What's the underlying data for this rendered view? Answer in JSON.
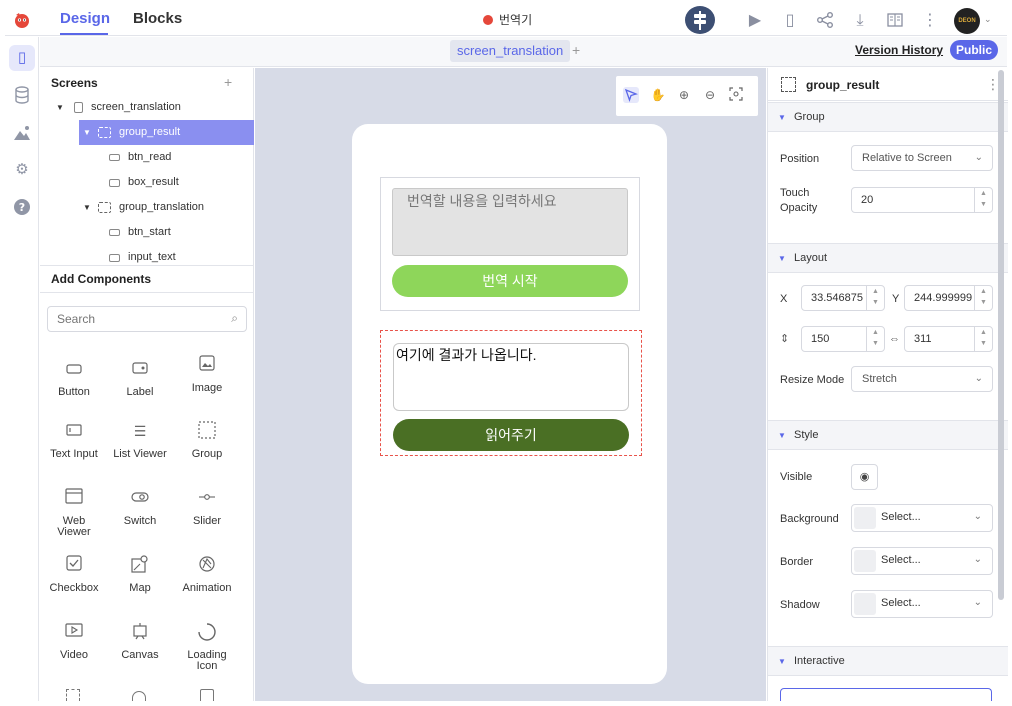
{
  "topbar": {
    "tabs": {
      "design": "Design",
      "blocks": "Blocks"
    },
    "app_title": "번역기",
    "avatar_text": "DEON"
  },
  "subbar": {
    "screen_tab": "screen_translation",
    "add_symbol": "+",
    "version_history": "Version History",
    "public_label": "Public"
  },
  "screens": {
    "title": "Screens",
    "add_symbol": "+",
    "tree": [
      {
        "label": "screen_translation"
      },
      {
        "label": "group_result"
      },
      {
        "label": "btn_read"
      },
      {
        "label": "box_result"
      },
      {
        "label": "group_translation"
      },
      {
        "label": "btn_start"
      },
      {
        "label": "input_text"
      }
    ]
  },
  "components": {
    "title": "Add Components",
    "search_placeholder": "Search",
    "items": [
      {
        "label": "Button",
        "icon": "button-icon"
      },
      {
        "label": "Label",
        "icon": "label-icon"
      },
      {
        "label": "Image",
        "icon": "image-icon"
      },
      {
        "label": "Text Input",
        "icon": "text-input-icon"
      },
      {
        "label": "List Viewer",
        "icon": "list-icon"
      },
      {
        "label": "Group",
        "icon": "group-icon"
      },
      {
        "label": "Web\nViewer",
        "icon": "web-viewer-icon"
      },
      {
        "label": "Switch",
        "icon": "switch-icon"
      },
      {
        "label": "Slider",
        "icon": "slider-icon"
      },
      {
        "label": "Checkbox",
        "icon": "checkbox-icon"
      },
      {
        "label": "Map",
        "icon": "map-icon"
      },
      {
        "label": "Animation",
        "icon": "animation-icon"
      },
      {
        "label": "Video",
        "icon": "video-icon"
      },
      {
        "label": "Canvas",
        "icon": "canvas-icon"
      },
      {
        "label": "Loading\nIcon",
        "icon": "loading-icon"
      }
    ]
  },
  "phone": {
    "input_placeholder": "번역할 내용을 입력하세요",
    "btn_start": "번역 시작",
    "box_result": "여기에 결과가 나옵니다.",
    "btn_read": "읽어주기"
  },
  "props": {
    "title": "group_result",
    "sections": {
      "group": "Group",
      "layout": "Layout",
      "style": "Style",
      "interactive": "Interactive"
    },
    "position_label": "Position",
    "position_value": "Relative to Screen",
    "touch_opacity_label": "Touch\nOpacity",
    "touch_opacity_value": "20",
    "x_label": "X",
    "x_value": "33.546875",
    "y_label": "Y",
    "y_value": "244.999999",
    "height_value": "150",
    "width_value": "311",
    "resize_mode_label": "Resize Mode",
    "resize_mode_value": "Stretch",
    "visible_label": "Visible",
    "background_label": "Background",
    "border_label": "Border",
    "shadow_label": "Shadow",
    "select_text": "Select..."
  },
  "colors": {
    "accent": "#5a67e8",
    "selection": "#8a8ff0",
    "btn_start": "#8ed65a",
    "btn_read": "#4a6f24",
    "canvas_bg": "#d7dbe7"
  }
}
